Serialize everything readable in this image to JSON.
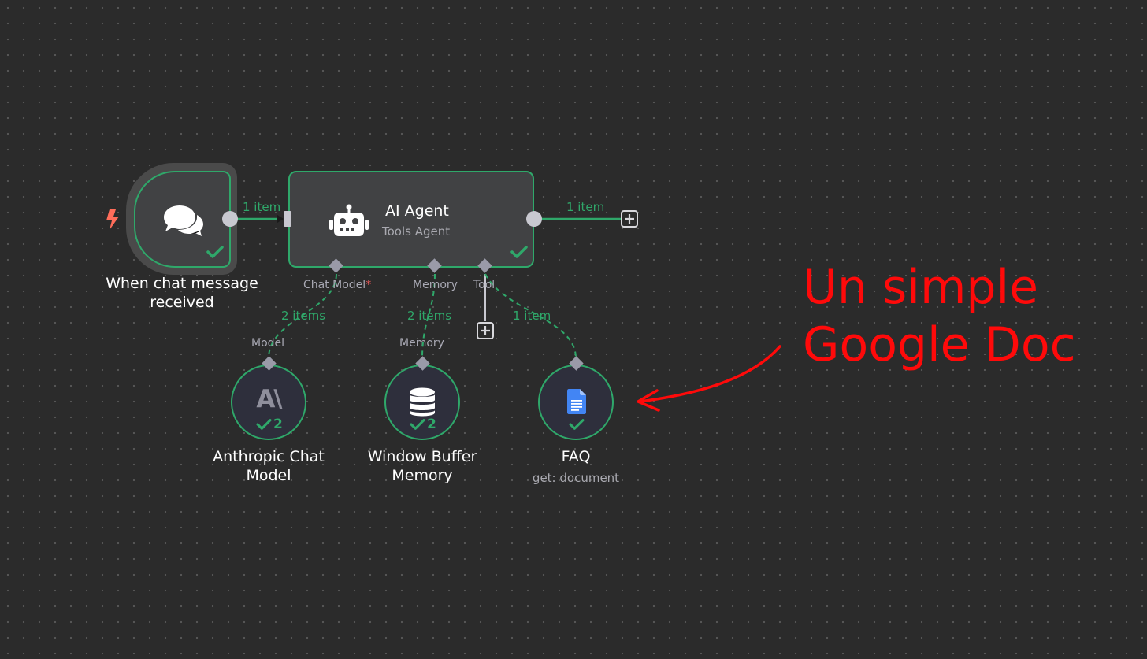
{
  "nodes": {
    "trigger": {
      "title_line1": "When chat message",
      "title_line2": "received",
      "icon": "chat-bubbles-icon",
      "status": "success"
    },
    "agent": {
      "title": "AI Agent",
      "subtitle": "Tools Agent",
      "icon": "robot-icon",
      "status": "success",
      "inputs": {
        "chat_model": "Chat Model",
        "required_mark": "*",
        "memory": "Memory",
        "tool": "Tool"
      }
    },
    "anthropic": {
      "title_line1": "Anthropic Chat",
      "title_line2": "Model",
      "icon": "anthropic-logo-icon",
      "logo_text": "A\\",
      "run_count": "2",
      "output_label": "Model"
    },
    "memory": {
      "title_line1": "Window Buffer",
      "title_line2": "Memory",
      "icon": "database-icon",
      "run_count": "2",
      "output_label": "Memory"
    },
    "faq": {
      "title": "FAQ",
      "subtitle": "get: document",
      "icon": "google-docs-icon"
    }
  },
  "connections": {
    "trigger_to_agent": "1 item",
    "agent_output": "1 item",
    "model_items": "2 items",
    "memory_items": "2 items",
    "tool_items": "1 item"
  },
  "annotation": {
    "line1": "Un simple",
    "line2": "Google Doc",
    "color": "#ff0a0a"
  },
  "colors": {
    "canvas": "#2b2b2b",
    "success": "#2fa86a",
    "node_bg": "#414244",
    "trigger_bolt": "#ff6d5a",
    "handle": "#c8c8d0"
  }
}
